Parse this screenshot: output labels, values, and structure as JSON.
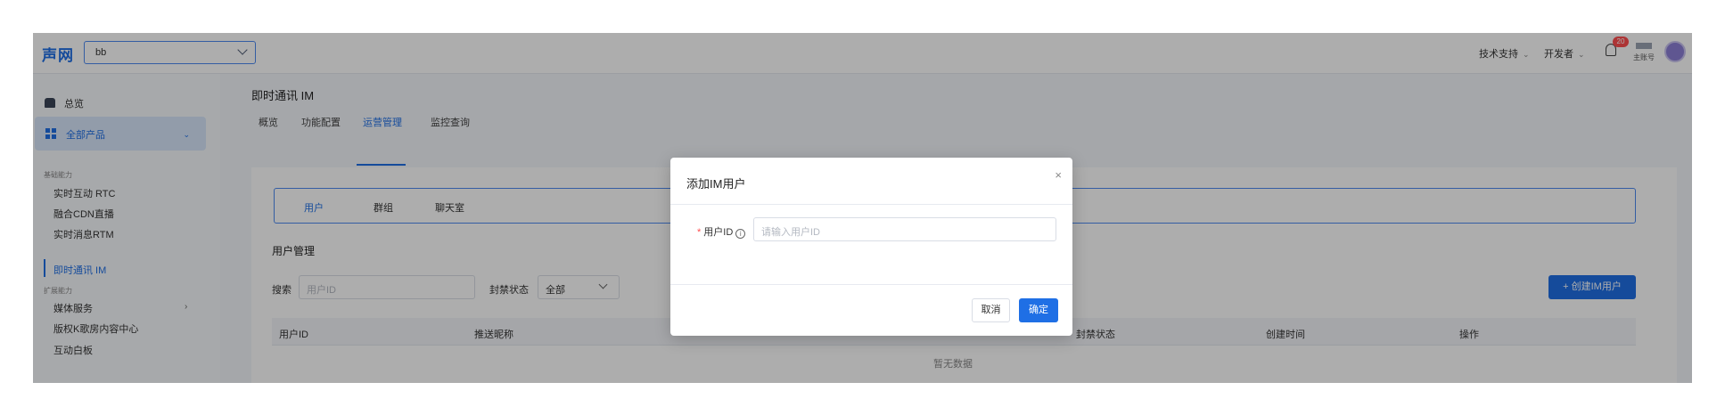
{
  "header": {
    "logo": "声网",
    "project_select": "bb",
    "support": "技术支持",
    "developer": "开发者",
    "notification_count": "20",
    "account_label": "主账号"
  },
  "sidebar": {
    "overview": "总览",
    "all_products": "全部产品",
    "category_basic": "基础能力",
    "items_basic": [
      "实时互动 RTC",
      "融合CDN直播",
      "实时消息RTM",
      "即时通讯 IM"
    ],
    "category_ext": "扩展能力",
    "items_ext": [
      "媒体服务",
      "版权K歌房内容中心",
      "互动白板"
    ]
  },
  "main": {
    "title": "即时通讯 IM",
    "tabs": [
      "概览",
      "功能配置",
      "运营管理",
      "监控查询"
    ],
    "subtabs": [
      "用户",
      "群组",
      "聊天室"
    ],
    "section_title": "用户管理",
    "search_label": "搜索",
    "search_placeholder": "用户ID",
    "ban_status_label": "封禁状态",
    "ban_status_value": "全部",
    "create_button": "+ 创建IM用户",
    "columns": [
      "用户ID",
      "推送昵称",
      "封禁状态",
      "创建时间",
      "操作"
    ],
    "empty_text": "暂无数据"
  },
  "modal": {
    "title": "添加IM用户",
    "close": "×",
    "field_label": "用户ID",
    "field_required": "*",
    "field_info": "i",
    "field_placeholder": "请输入用户ID",
    "cancel": "取消",
    "confirm": "确定"
  },
  "colors": {
    "primary": "#1f6fe5",
    "overlay": "rgba(0,0,0,0.32)"
  }
}
